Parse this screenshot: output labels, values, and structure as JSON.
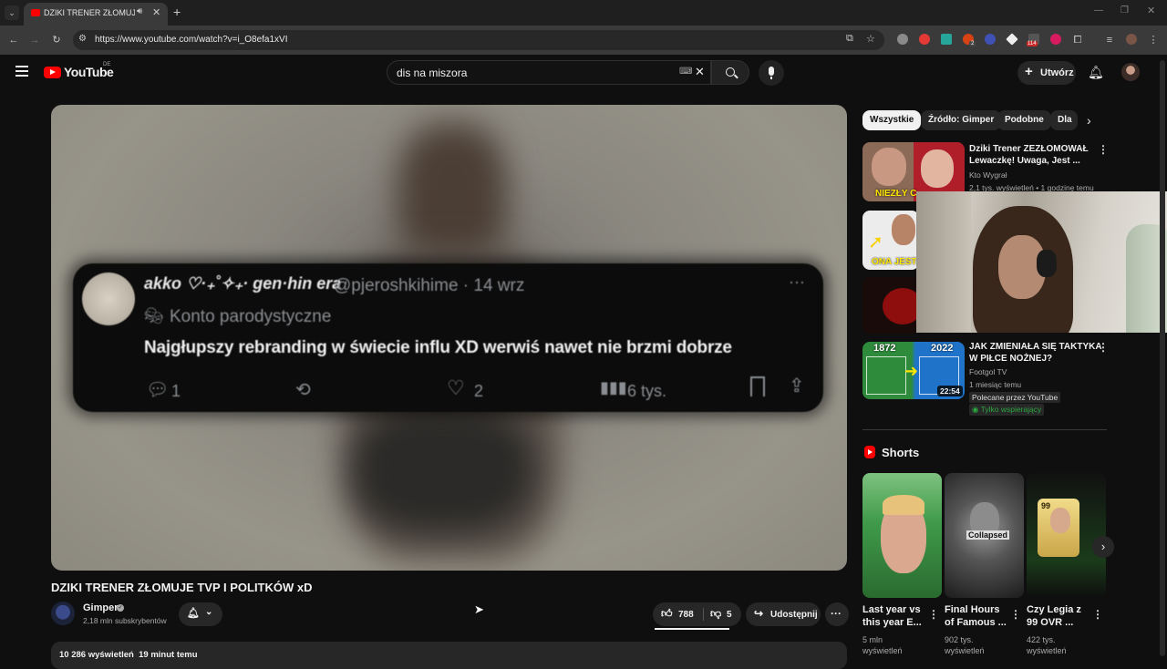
{
  "browser": {
    "tab_title": "DZIKI TRENER ZŁOMUJE TV",
    "url": "https://www.youtube.com/watch?v=i_O8efa1xVI",
    "ext_badge_a": "2",
    "ext_badge_b": "114"
  },
  "header": {
    "logo": "YouTube",
    "region": "DE",
    "search_value": "dis na miszora",
    "create_label": "Utwórz"
  },
  "player": {
    "tweet": {
      "name": "akko ♡·₊˚✧₊· gen·hin era",
      "handle": "@pjeroshkihime · 14 wrz",
      "badge": "Konto parodystyczne",
      "text": "Najgłupszy rebranding w świecie influ XD werwiś nawet nie brzmi dobrze",
      "replies": "1",
      "likes": "2",
      "views": "6 tys."
    }
  },
  "video": {
    "title": "DZIKI TRENER ZŁOMUJE TVP I POLITKÓW xD",
    "channel": "Gimper",
    "subscribers": "2,18 mln subskrybentów",
    "likes": "788",
    "dislikes": "5",
    "share_label": "Udostępnij",
    "views_line": "10 286 wyświetleń  19 minut temu"
  },
  "sidebar": {
    "chips": [
      "Wszystkie",
      "Źródło: Gimper",
      "Podobne",
      "Dla"
    ],
    "items": [
      {
        "title_1": "Dziki Trener ZEZŁOMOWAŁ",
        "title_2": "Lewaczkę! Uwaga, Jest ...",
        "channel": "Kto Wygrał",
        "meta": "2,1 tys. wyświetleń • 1 godzinę temu",
        "thumb_text": "NIEZŁY C"
      },
      {
        "thumb_text": "ONA JEST"
      },
      {
        "title_1": "JAK ZMIENIAŁA SIĘ TAKTYKA",
        "title_2": "W PIŁCE NOŻNEJ?",
        "channel": "Footgol TV",
        "meta": "1 miesiąc temu",
        "badge_1": "Polecane przez YouTube",
        "badge_2": "Tylko wspierający",
        "thumb_year_a": "1872",
        "thumb_year_b": "2022",
        "duration": "22:54"
      }
    ],
    "shorts_heading": "Shorts",
    "shorts": [
      {
        "title": "Last year vs this year E...",
        "views": "5 mln wyświetleń"
      },
      {
        "title": "Final Hours of Famous ...",
        "views": "902 tys. wyświetleń",
        "thumb_text": "Collapsed"
      },
      {
        "title": "Czy Legia z 99 OVR ...",
        "views": "422 tys. wyświetleń",
        "thumb_text": "99"
      }
    ]
  },
  "colors": {
    "background": "#0f0f0f",
    "youtube_red": "#ff0000",
    "chip_active": "#f1f1f1",
    "supporters_green": "#2ba640"
  }
}
